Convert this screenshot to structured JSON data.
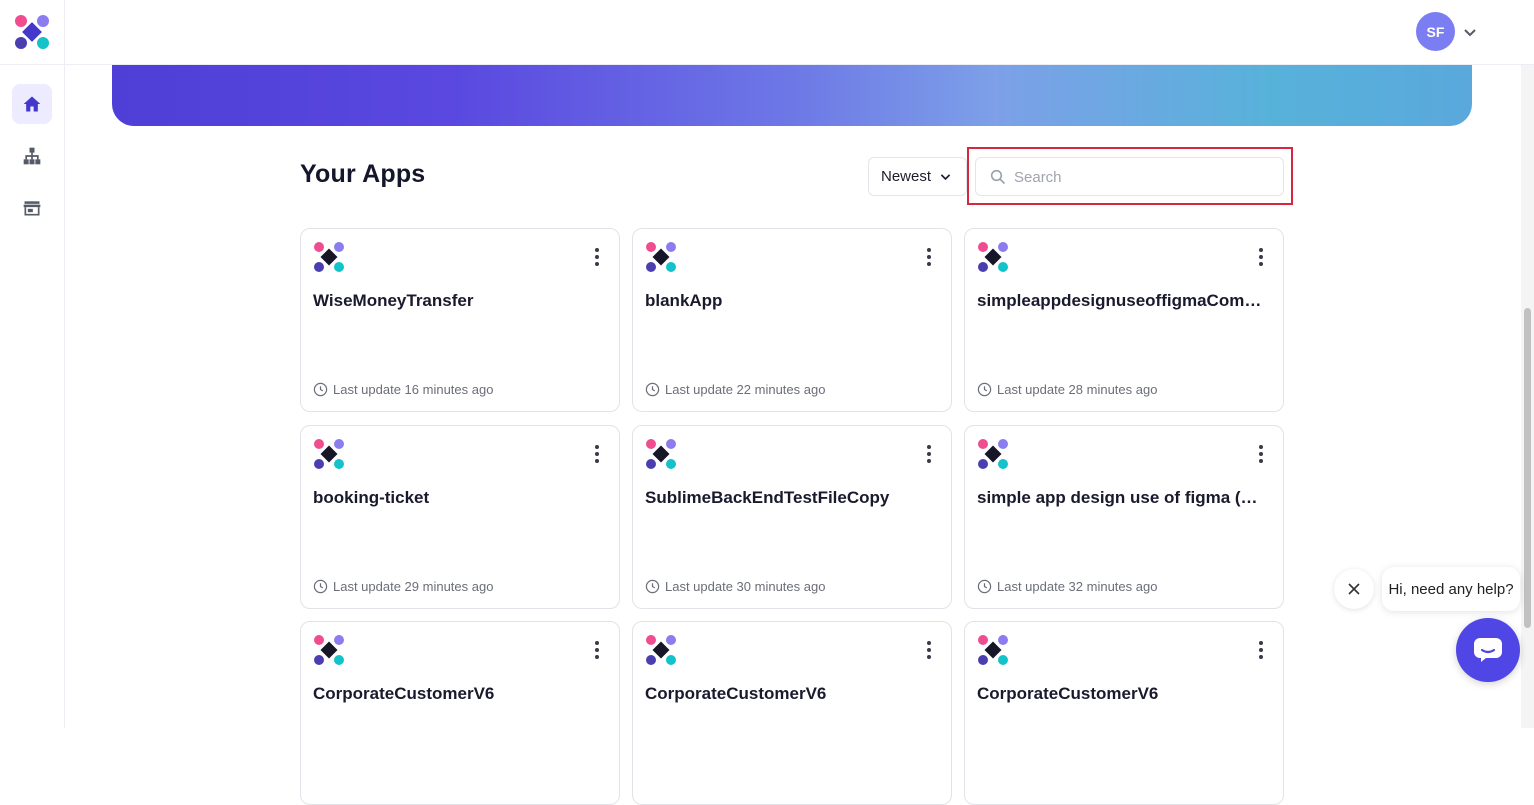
{
  "header": {
    "avatar_initials": "SF"
  },
  "sidebar": {
    "items": [
      {
        "name": "home",
        "icon": "home-icon",
        "active": true
      },
      {
        "name": "hierarchy",
        "icon": "sitemap-icon",
        "active": false
      },
      {
        "name": "store",
        "icon": "store-icon",
        "active": false
      }
    ]
  },
  "main": {
    "title": "Your Apps",
    "sort": {
      "selected": "Newest"
    },
    "search": {
      "placeholder": "Search",
      "value": ""
    },
    "apps": [
      {
        "name": "WiseMoneyTransfer",
        "updated": "Last update 16 minutes ago"
      },
      {
        "name": "blankApp",
        "updated": "Last update 22 minutes ago"
      },
      {
        "name": "simpleappdesignuseoffigmaCom…",
        "updated": "Last update 28 minutes ago"
      },
      {
        "name": "booking-ticket",
        "updated": "Last update 29 minutes ago"
      },
      {
        "name": "SublimeBackEndTestFileCopy",
        "updated": "Last update 30 minutes ago"
      },
      {
        "name": "simple app design use of figma (…",
        "updated": "Last update 32 minutes ago"
      },
      {
        "name": "CorporateCustomerV6",
        "updated": ""
      },
      {
        "name": "CorporateCustomerV6",
        "updated": ""
      },
      {
        "name": "CorporateCustomerV6",
        "updated": ""
      }
    ]
  },
  "chat": {
    "greeting": "Hi, need any help?"
  },
  "colors": {
    "accent": "#4f46e5",
    "highlight": "#d7263d",
    "avatar": "#7b7ef2"
  }
}
